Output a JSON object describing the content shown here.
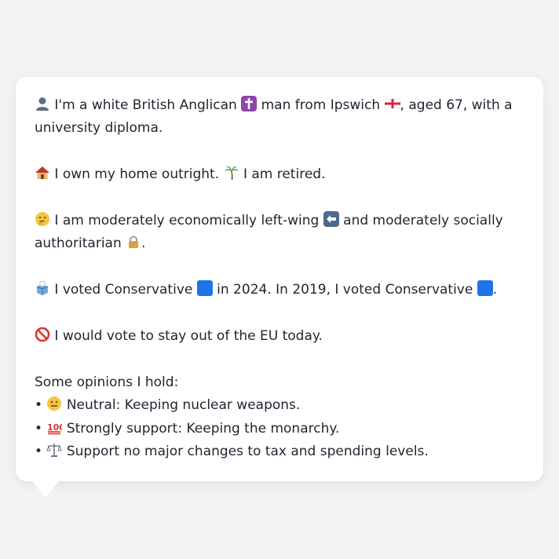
{
  "profile": {
    "line1": {
      "icon": "person-silhouette-icon",
      "text_a": "I'm a white British Anglican",
      "icon_cross": "latin-cross-icon",
      "text_b": "man from Ipswich",
      "icon_flag": "england-flag-icon",
      "text_c": ", aged 67, with a",
      "text_d": "university diploma."
    },
    "line2": {
      "icon_house": "house-icon",
      "text_a": "I own my home outright.",
      "icon_palm": "palm-tree-icon",
      "text_b": "I am retired."
    },
    "line3": {
      "icon_think": "thinking-face-icon",
      "text_a": "I am moderately economically left-wing",
      "icon_arrow": "left-arrow-icon",
      "text_b": "and moderately socially",
      "text_c": "authoritarian",
      "icon_lock": "lock-icon",
      "text_d": "."
    },
    "line4": {
      "icon_ballot": "ballot-box-icon",
      "text_a": "I voted Conservative",
      "text_b": "in 2024. In 2019, I voted Conservative",
      "text_c": ".",
      "party_color": "#1d74e8"
    },
    "line5": {
      "icon_no": "prohibited-icon",
      "text_a": "I would vote to stay out of the EU today."
    },
    "opinions": {
      "heading": "Some opinions I hold:",
      "items": [
        {
          "icon": "neutral-face-icon",
          "text": "Neutral: Keeping nuclear weapons."
        },
        {
          "icon": "hundred-points-icon",
          "text": "Strongly support: Keeping the monarchy."
        },
        {
          "icon": "balance-scale-icon",
          "text": "Support no major changes to tax and spending levels."
        }
      ]
    }
  }
}
